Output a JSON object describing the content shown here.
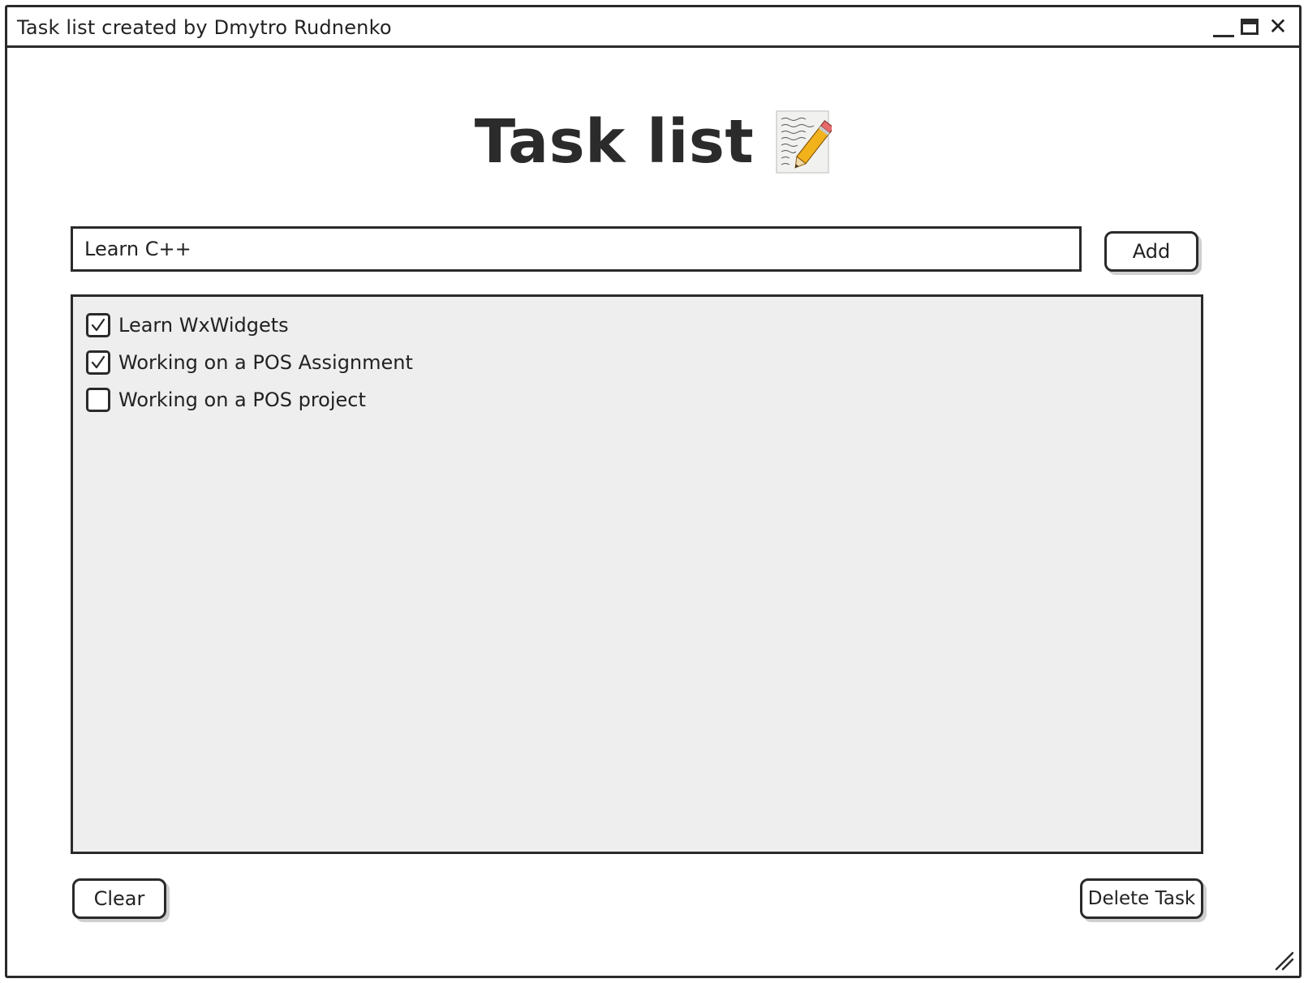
{
  "window": {
    "title": "Task list created by Dmytro Rudnenko",
    "controls": [
      "minimize-icon",
      "maximize-icon",
      "close-icon"
    ],
    "close_glyph": "✕"
  },
  "header": {
    "title": "Task list",
    "icon": "memo-icon"
  },
  "input": {
    "value": "Learn C++",
    "add_label": "Add"
  },
  "tasks": [
    {
      "label": "Learn WxWidgets",
      "checked": true
    },
    {
      "label": "Working on a POS Assignment",
      "checked": true
    },
    {
      "label": "Working on a POS project",
      "checked": false
    }
  ],
  "actions": {
    "clear_label": "Clear",
    "delete_label": "Delete Task"
  },
  "colors": {
    "border": "#2a2a2a",
    "list_background": "#eeeeee",
    "shadow": "#cfcfcf"
  }
}
